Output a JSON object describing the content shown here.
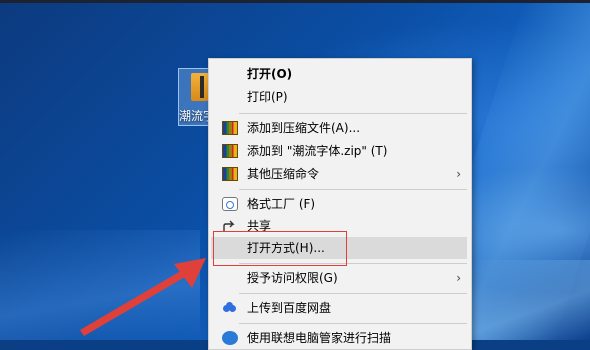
{
  "desktop": {
    "icon_label": "潮流字体"
  },
  "menu": {
    "items": [
      {
        "label": "打开(O)"
      },
      {
        "label": "打印(P)"
      },
      {
        "label": "添加到压缩文件(A)..."
      },
      {
        "label": "添加到 \"潮流字体.zip\" (T)"
      },
      {
        "label": "其他压缩命令"
      },
      {
        "label": "格式工厂 (F)"
      },
      {
        "label": "共享"
      },
      {
        "label": "打开方式(H)..."
      },
      {
        "label": "授予访问权限(G)"
      },
      {
        "label": "上传到百度网盘"
      },
      {
        "label": "使用联想电脑管家进行扫描"
      }
    ],
    "submenu_arrow": "›"
  },
  "colors": {
    "highlight_box": "#e0403a",
    "arrow": "#e0403a",
    "hover": "#dadada"
  }
}
